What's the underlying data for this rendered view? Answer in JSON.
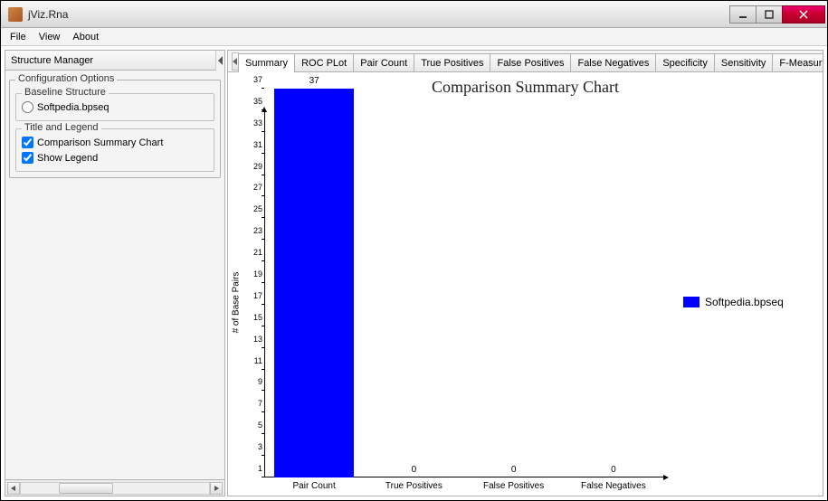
{
  "window": {
    "title": "jViz.Rna"
  },
  "menubar": [
    "File",
    "View",
    "About"
  ],
  "sidebar": {
    "header": "Structure Manager",
    "config_title": "Configuration Options",
    "baseline": {
      "title": "Baseline Structure",
      "option": "Softpedia.bpseq",
      "selected": false
    },
    "title_legend": {
      "title": "Title and Legend",
      "chart_title_check": {
        "label": "Comparison Summary Chart",
        "checked": true
      },
      "show_legend": {
        "label": "Show Legend",
        "checked": true
      }
    }
  },
  "tabs": [
    "Summary",
    "ROC PLot",
    "Pair Count",
    "True Positives",
    "False Positives",
    "False Negatives",
    "Specificity",
    "Sensitivity",
    "F-Measure"
  ],
  "selected_tab": 0,
  "chart_data": {
    "type": "bar",
    "title": "Comparison Summary Chart",
    "ylabel": "# of Base Pairs",
    "xlabel": "",
    "categories": [
      "Pair Count",
      "True Positives",
      "False Positives",
      "False Negatives"
    ],
    "series": [
      {
        "name": "Softpedia.bpseq",
        "values": [
          37,
          0,
          0,
          0
        ],
        "color": "#0000ff"
      }
    ],
    "ylim": [
      1,
      37
    ],
    "yticks": [
      1,
      3,
      5,
      7,
      9,
      11,
      13,
      15,
      17,
      19,
      21,
      23,
      25,
      27,
      29,
      31,
      33,
      35,
      37
    ]
  },
  "legend": {
    "label": "Softpedia.bpseq"
  }
}
